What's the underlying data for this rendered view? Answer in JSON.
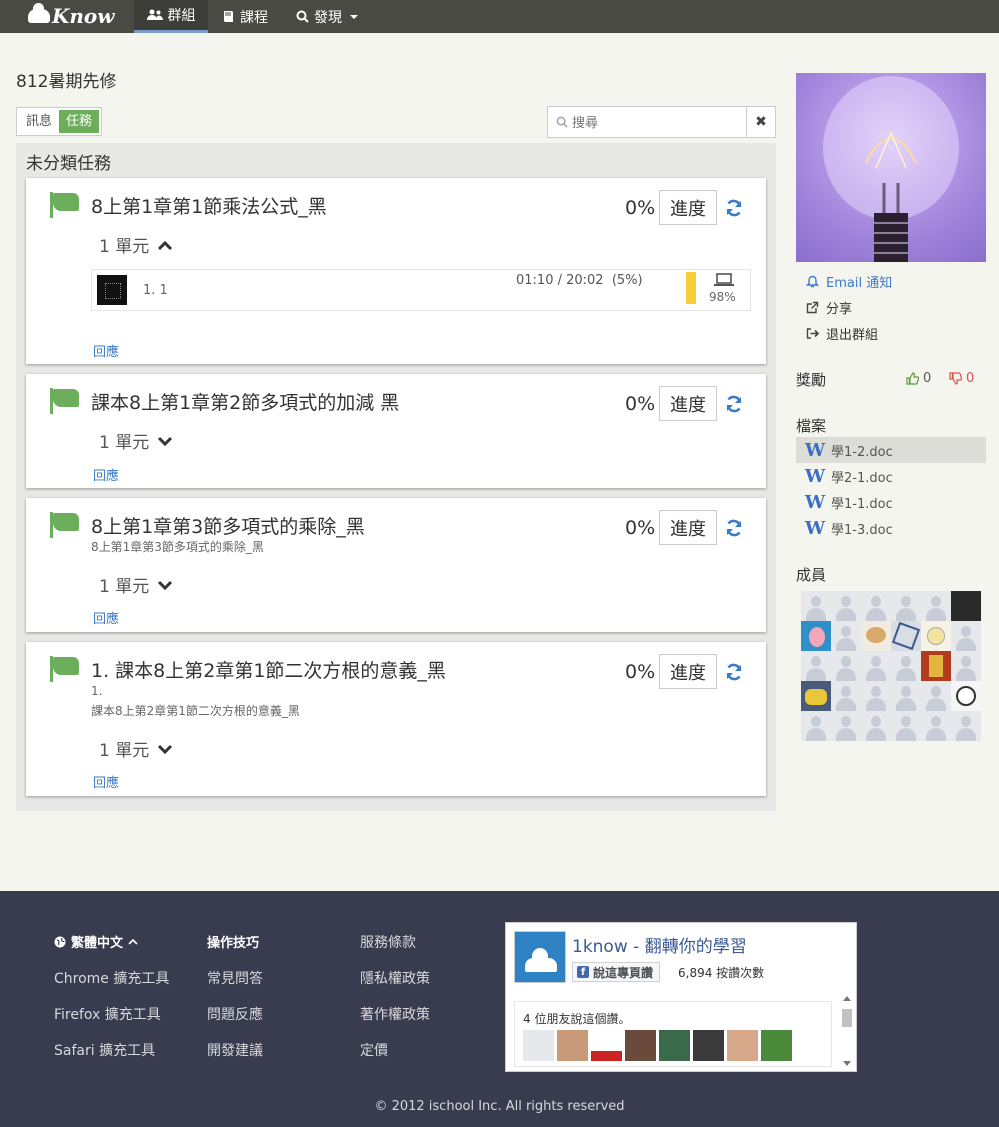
{
  "nav": {
    "brand": "Know",
    "items": [
      {
        "label": "群組",
        "active": true
      },
      {
        "label": "課程",
        "active": false
      },
      {
        "label": "發現",
        "active": false
      }
    ]
  },
  "group": {
    "title": "812暑期先修",
    "tabs": [
      "訊息",
      "任務"
    ],
    "active_tab": "任務",
    "search_placeholder": "搜尋",
    "section_title": "未分類任務"
  },
  "tasks": [
    {
      "title": "8上第1章第1節乘法公式_黑",
      "percent": "0%",
      "progress_label": "進度",
      "units_label": "1 單元",
      "expanded": true,
      "reply_label": "回應",
      "unit": {
        "name": "1. 1",
        "time": "01:10 / 20:02",
        "time_pct": "(5%)",
        "device_pct": "98%"
      }
    },
    {
      "title": "課本8上第1章第2節多項式的加減 黑",
      "percent": "0%",
      "progress_label": "進度",
      "units_label": "1 單元",
      "expanded": false,
      "reply_label": "回應"
    },
    {
      "title": "8上第1章第3節多項式的乘除_黑",
      "subtitle": "8上第1章第3節多項式的乘除_黑",
      "percent": "0%",
      "progress_label": "進度",
      "units_label": "1 單元",
      "expanded": false,
      "reply_label": "回應"
    },
    {
      "title": "1. 課本8上第2章第1節二次方根的意義_黑",
      "subtitle_line1": "1.",
      "subtitle_line2": "課本8上第2章第1節二次方根的意義_黑",
      "percent": "0%",
      "progress_label": "進度",
      "units_label": "1 單元",
      "expanded": false,
      "reply_label": "回應"
    }
  ],
  "sidebar": {
    "links": [
      {
        "label": "Email 通知",
        "icon": "bell-icon",
        "color": "#3a7bc8"
      },
      {
        "label": "分享",
        "icon": "share-icon",
        "color": "#333333"
      },
      {
        "label": "退出群組",
        "icon": "sign-out-icon",
        "color": "#333333"
      }
    ],
    "rewards_label": "獎勵",
    "thumbs_up": "0",
    "thumbs_down": "0",
    "files_label": "檔案",
    "files": [
      "學1-2.doc",
      "學2-1.doc",
      "學1-1.doc",
      "學1-3.doc"
    ],
    "members_label": "成員"
  },
  "footer": {
    "language": "繁體中文",
    "col1": [
      "Chrome 擴充工具",
      "Firefox 擴充工具",
      "Safari 擴充工具"
    ],
    "col2_title": "操作技巧",
    "col2": [
      "常見問答",
      "問題反應",
      "開發建議"
    ],
    "col3": [
      "服務條款",
      "隱私權政策",
      "著作權政策",
      "定價"
    ],
    "copyright": "© 2012 ischool Inc. All rights reserved"
  },
  "facebook": {
    "page_name": "1know",
    "tagline": " - 翻轉你的學習",
    "like_button": "說這專頁讚",
    "like_count": "6,894 按讚次數",
    "friends_text": "4 位朋友說這個讚。"
  },
  "colors": {
    "accent_green": "#6cae5c",
    "link_blue": "#3a7bc8",
    "navbar": "#4a4a45",
    "footer": "#393b4f",
    "progress_yellow": "#f6cf3b",
    "thumbs_up_green": "#5a9a3c",
    "thumbs_down_red": "#d9534f"
  }
}
